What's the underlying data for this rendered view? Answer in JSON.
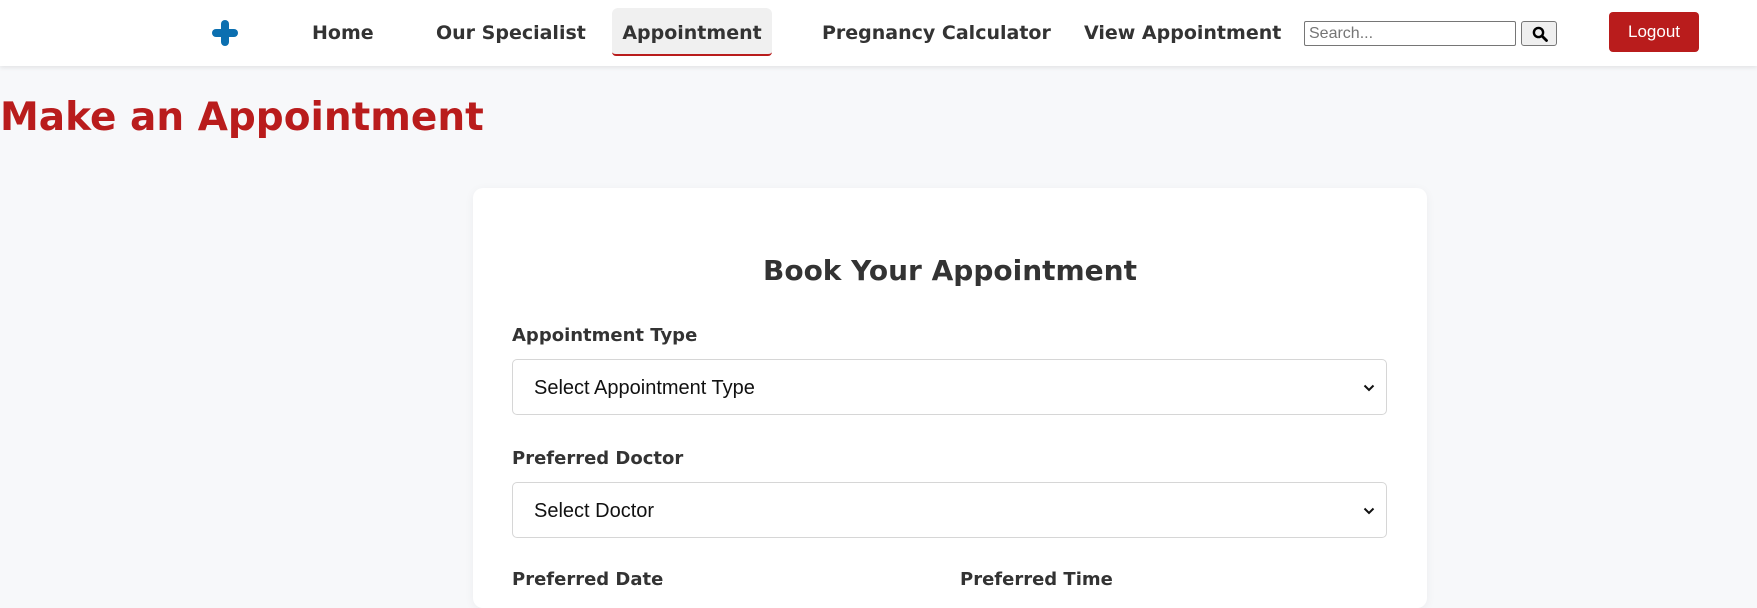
{
  "navbar": {
    "logo_icon": "medical-cross-icon",
    "links": [
      {
        "label": "Home",
        "active": false
      },
      {
        "label": "Our Specialist",
        "active": false
      },
      {
        "label": "Appointment",
        "active": true
      },
      {
        "label": "Pregnancy Calculator",
        "active": false
      },
      {
        "label": "View Appointment",
        "active": false
      }
    ],
    "search": {
      "placeholder": "Search...",
      "value": "",
      "icon": "search-icon"
    },
    "logout_label": "Logout"
  },
  "page": {
    "title": "Make an Appointment"
  },
  "form": {
    "title": "Book Your Appointment",
    "appointment_type": {
      "label": "Appointment Type",
      "value": "Select Appointment Type",
      "icon": "chevron-down-icon"
    },
    "preferred_doctor": {
      "label": "Preferred Doctor",
      "value": "Select Doctor",
      "icon": "chevron-down-icon"
    },
    "preferred_date": {
      "label": "Preferred Date"
    },
    "preferred_time": {
      "label": "Preferred Time"
    }
  },
  "colors": {
    "brand_red": "#b91c1c",
    "logo_blue": "#0b6fb0",
    "background": "#f7f8fa"
  }
}
